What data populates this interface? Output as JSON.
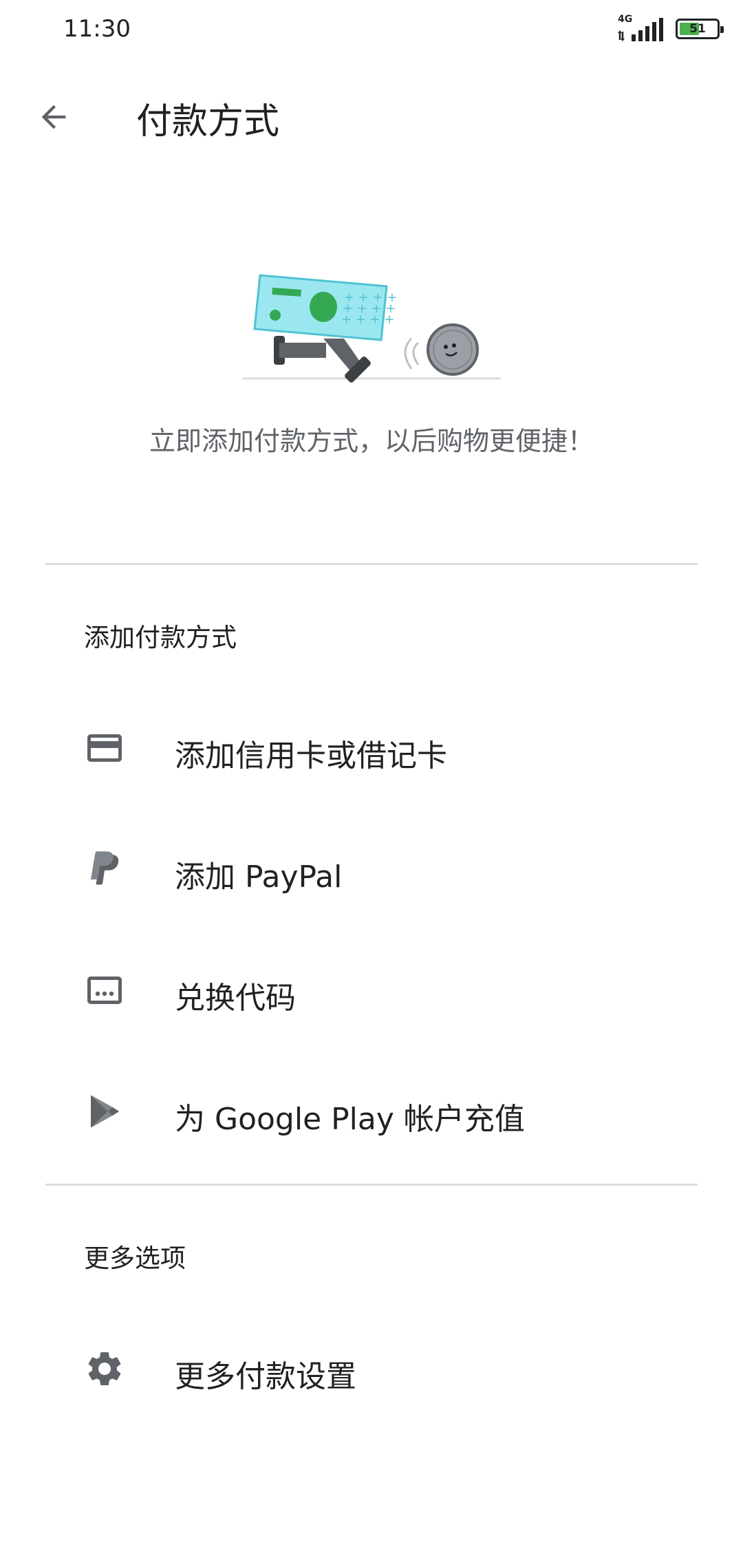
{
  "status_bar": {
    "time": "11:30",
    "network": "4G",
    "battery_level": "51",
    "battery_fraction": 0.51
  },
  "header": {
    "title": "付款方式"
  },
  "promo": {
    "text": "立即添加付款方式，以后购物更便捷！"
  },
  "add_section": {
    "heading": "添加付款方式",
    "items": [
      {
        "label": "添加信用卡或借记卡",
        "icon": "credit-card-icon"
      },
      {
        "label": "添加 PayPal",
        "icon": "paypal-icon"
      },
      {
        "label": "兑换代码",
        "icon": "redeem-code-icon"
      },
      {
        "label": "为 Google Play 帐户充值",
        "icon": "google-play-icon"
      }
    ]
  },
  "more_section": {
    "heading": "更多选项",
    "items": [
      {
        "label": "更多付款设置",
        "icon": "gear-icon"
      }
    ]
  },
  "colors": {
    "icon": "#5f6368",
    "divider": "#dadce0",
    "text_primary": "#202124",
    "text_secondary": "#5f6368",
    "battery": "#4caf50"
  }
}
